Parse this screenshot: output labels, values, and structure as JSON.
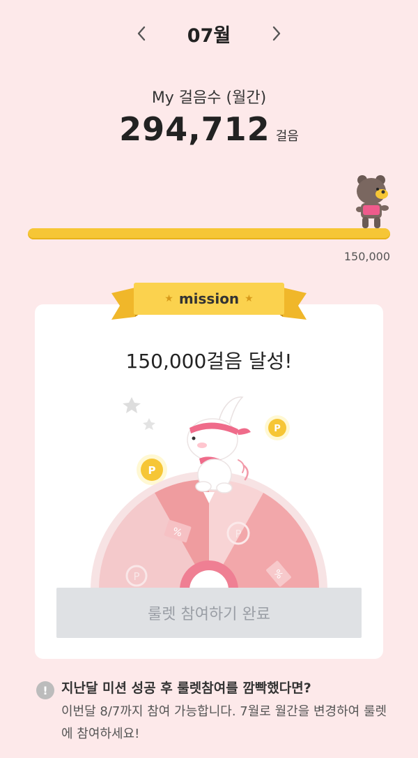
{
  "header": {
    "month": "07월",
    "prev_icon": "chevron-left-icon",
    "next_icon": "chevron-right-icon"
  },
  "summary": {
    "label": "My 걸음수 (월간)",
    "steps": "294,712",
    "unit": "걸음"
  },
  "progress": {
    "fraction": 1.0,
    "goal_label": "150,000",
    "fill_color": "#f6c636"
  },
  "mission": {
    "badge": "mission",
    "title": "150,000걸음 달성!",
    "button_label": "룰렛 참여하기 완료"
  },
  "notice": {
    "icon": "exclamation-icon",
    "title": "지난달 미션 성공 후 룰렛참여를 깜빡했다면?",
    "description": "이번달 8/7까지 참여 가능합니다. 7월로 월간을 변경하여 룰렛에 참여하세요!"
  },
  "colors": {
    "background": "#fde9ea",
    "accent_yellow": "#f6c636",
    "accent_pink": "#ef6b8a"
  }
}
